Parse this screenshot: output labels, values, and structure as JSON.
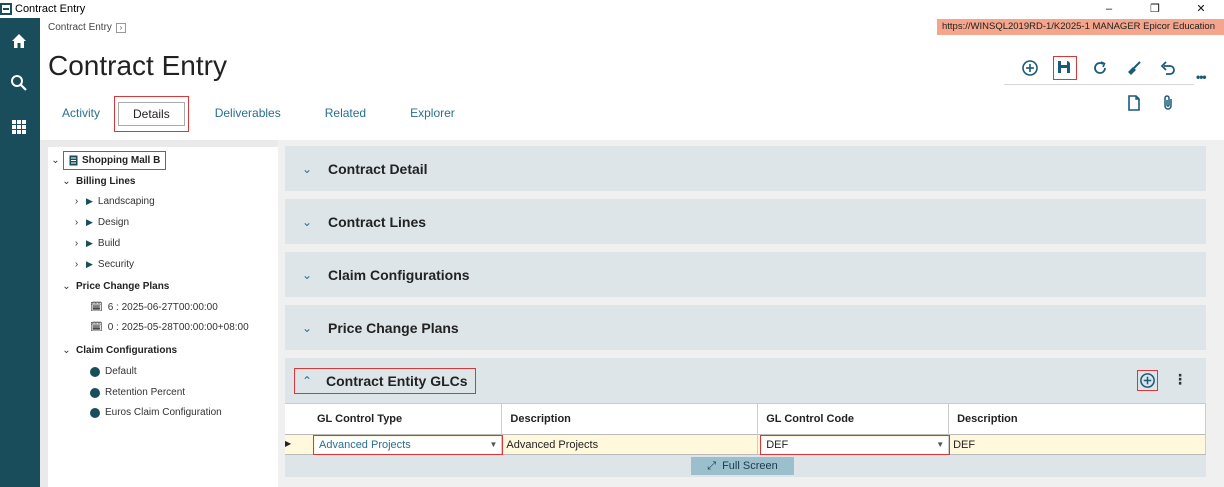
{
  "window": {
    "title": "Contract Entry",
    "minimize": "–",
    "maximize": "❐",
    "close": "✕"
  },
  "rail": {
    "home_icon": "home-icon",
    "search_icon": "search-icon",
    "apps_icon": "apps-grid-icon"
  },
  "breadcrumb": {
    "label": "Contract Entry",
    "chevron": "›"
  },
  "env": {
    "text": "https://WINSQL2019RD-1/K2025-1   MANAGER   Epicor Education"
  },
  "page": {
    "title": "Contract Entry"
  },
  "toolbar": {
    "more": "•••"
  },
  "tabs": [
    {
      "label": "Activity"
    },
    {
      "label": "Details"
    },
    {
      "label": "Deliverables"
    },
    {
      "label": "Related"
    },
    {
      "label": "Explorer"
    }
  ],
  "tree": {
    "root": "Shopping Mall B",
    "billing": {
      "label": "Billing Lines",
      "items": [
        "Landscaping",
        "Design",
        "Build",
        "Security"
      ]
    },
    "price_plans": {
      "label": "Price Change Plans",
      "items": [
        "6 : 2025-06-27T00:00:00",
        "0 : 2025-05-28T00:00:00+08:00"
      ]
    },
    "claims": {
      "label": "Claim Configurations",
      "items": [
        "Default",
        "Retention Percent",
        "Euros Claim Configuration"
      ]
    }
  },
  "sections": [
    {
      "title": "Contract Detail"
    },
    {
      "title": "Contract Lines"
    },
    {
      "title": "Claim Configurations"
    },
    {
      "title": "Price Change Plans"
    },
    {
      "title": "Contract Entity GLCs"
    }
  ],
  "grid": {
    "headers": [
      "GL Control Type",
      "Description",
      "GL Control Code",
      "Description"
    ],
    "row": {
      "gl_type": "Advanced Projects",
      "description": "Advanced Projects",
      "gl_code": "DEF",
      "code_description": "DEF"
    },
    "full_screen": "Full Screen"
  },
  "colors": {
    "rail": "#1a4d5c",
    "accent": "#2a6f8f",
    "highlight": "#d9383a",
    "section": "#dde5e9"
  }
}
